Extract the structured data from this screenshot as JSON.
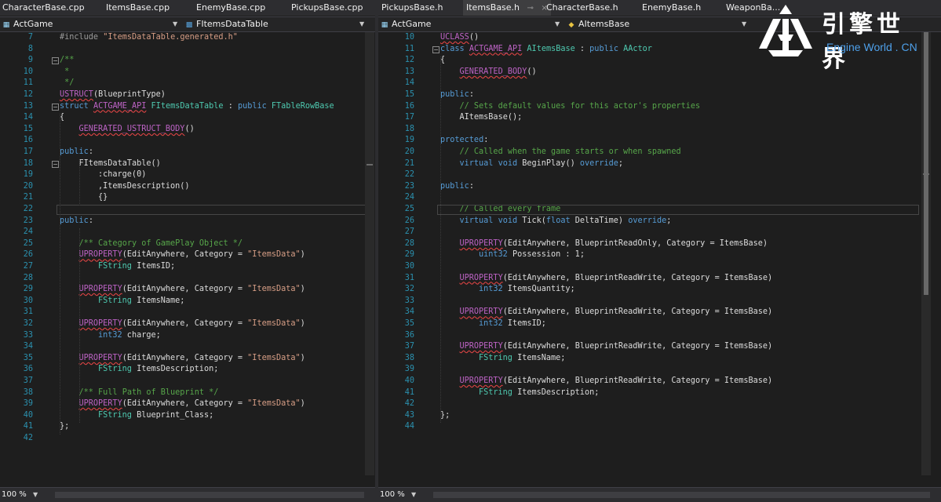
{
  "left_editor": {
    "tabs": [
      {
        "label": "CharacterBase.cpp"
      },
      {
        "label": "ItemsBase.cpp"
      },
      {
        "label": "EnemyBase.cpp"
      },
      {
        "label": "PickupsBase.cpp"
      }
    ],
    "project_label": "ActGame",
    "scope_label": "FItemsDataTable",
    "zoom": "100 %",
    "lines": [
      {
        "n": "7",
        "indent": 0,
        "segs": [
          {
            "c": "p",
            "t": "#include "
          },
          {
            "c": "s",
            "t": "\"ItemsDataTable.generated.h\""
          }
        ]
      },
      {
        "n": "8",
        "indent": 0,
        "segs": []
      },
      {
        "n": "9",
        "indent": 0,
        "segs": [
          {
            "c": "c",
            "t": "/**"
          }
        ]
      },
      {
        "n": "10",
        "indent": 0,
        "segs": [
          {
            "c": "c",
            "t": " *"
          }
        ]
      },
      {
        "n": "11",
        "indent": 0,
        "segs": [
          {
            "c": "c",
            "t": " */"
          }
        ]
      },
      {
        "n": "12",
        "indent": 0,
        "segs": [
          {
            "c": "m u",
            "t": "USTRUCT"
          },
          {
            "c": "pl",
            "t": "(BlueprintType)"
          }
        ]
      },
      {
        "n": "13",
        "indent": 0,
        "segs": [
          {
            "c": "k",
            "t": "struct "
          },
          {
            "c": "m u",
            "t": "ACTGAME_API"
          },
          {
            "c": "pl",
            "t": " "
          },
          {
            "c": "t",
            "t": "FItemsDataTable"
          },
          {
            "c": "pl",
            "t": " : "
          },
          {
            "c": "k",
            "t": "public "
          },
          {
            "c": "t",
            "t": "FTableRowBase"
          }
        ]
      },
      {
        "n": "14",
        "indent": 0,
        "segs": [
          {
            "c": "pl",
            "t": "{"
          }
        ]
      },
      {
        "n": "15",
        "indent": 1,
        "segs": [
          {
            "c": "m u",
            "t": "GENERATED_USTRUCT_BODY"
          },
          {
            "c": "pl",
            "t": "()"
          }
        ]
      },
      {
        "n": "16",
        "indent": 0,
        "segs": []
      },
      {
        "n": "17",
        "indent": 0,
        "segs": [
          {
            "c": "k",
            "t": "public"
          },
          {
            "c": "pl",
            "t": ":"
          }
        ]
      },
      {
        "n": "18",
        "indent": 1,
        "segs": [
          {
            "c": "pl",
            "t": "FItemsDataTable()"
          }
        ]
      },
      {
        "n": "19",
        "indent": 2,
        "segs": [
          {
            "c": "pl",
            "t": ":charge(0)"
          }
        ]
      },
      {
        "n": "20",
        "indent": 2,
        "segs": [
          {
            "c": "pl",
            "t": ",ItemsDescription()"
          }
        ]
      },
      {
        "n": "21",
        "indent": 2,
        "segs": [
          {
            "c": "pl",
            "t": "{}"
          }
        ]
      },
      {
        "n": "22",
        "indent": 0,
        "segs": []
      },
      {
        "n": "23",
        "indent": 0,
        "segs": [
          {
            "c": "k",
            "t": "public"
          },
          {
            "c": "pl",
            "t": ":"
          }
        ]
      },
      {
        "n": "24",
        "indent": 0,
        "segs": []
      },
      {
        "n": "25",
        "indent": 1,
        "segs": [
          {
            "c": "c",
            "t": "/** Category of GamePlay Object */"
          }
        ]
      },
      {
        "n": "26",
        "indent": 1,
        "segs": [
          {
            "c": "m u",
            "t": "UPROPERTY"
          },
          {
            "c": "pl",
            "t": "(EditAnywhere, Category = "
          },
          {
            "c": "s",
            "t": "\"ItemsData\""
          },
          {
            "c": "pl",
            "t": ")"
          }
        ]
      },
      {
        "n": "27",
        "indent": 2,
        "segs": [
          {
            "c": "t",
            "t": "FString"
          },
          {
            "c": "pl",
            "t": " ItemsID;"
          }
        ]
      },
      {
        "n": "28",
        "indent": 0,
        "segs": []
      },
      {
        "n": "29",
        "indent": 1,
        "segs": [
          {
            "c": "m u",
            "t": "UPROPERTY"
          },
          {
            "c": "pl",
            "t": "(EditAnywhere, Category = "
          },
          {
            "c": "s",
            "t": "\"ItemsData\""
          },
          {
            "c": "pl",
            "t": ")"
          }
        ]
      },
      {
        "n": "30",
        "indent": 2,
        "segs": [
          {
            "c": "t",
            "t": "FString"
          },
          {
            "c": "pl",
            "t": " ItemsName;"
          }
        ]
      },
      {
        "n": "31",
        "indent": 0,
        "segs": []
      },
      {
        "n": "32",
        "indent": 1,
        "segs": [
          {
            "c": "m u",
            "t": "UPROPERTY"
          },
          {
            "c": "pl",
            "t": "(EditAnywhere, Category = "
          },
          {
            "c": "s",
            "t": "\"ItemsData\""
          },
          {
            "c": "pl",
            "t": ")"
          }
        ]
      },
      {
        "n": "33",
        "indent": 2,
        "segs": [
          {
            "c": "k",
            "t": "int32"
          },
          {
            "c": "pl",
            "t": " charge;"
          }
        ]
      },
      {
        "n": "34",
        "indent": 0,
        "segs": []
      },
      {
        "n": "35",
        "indent": 1,
        "segs": [
          {
            "c": "m u",
            "t": "UPROPERTY"
          },
          {
            "c": "pl",
            "t": "(EditAnywhere, Category = "
          },
          {
            "c": "s",
            "t": "\"ItemsData\""
          },
          {
            "c": "pl",
            "t": ")"
          }
        ]
      },
      {
        "n": "36",
        "indent": 2,
        "segs": [
          {
            "c": "t",
            "t": "FString"
          },
          {
            "c": "pl",
            "t": " ItemsDescription;"
          }
        ]
      },
      {
        "n": "37",
        "indent": 0,
        "segs": []
      },
      {
        "n": "38",
        "indent": 1,
        "segs": [
          {
            "c": "c",
            "t": "/** Full Path of Blueprint */"
          }
        ]
      },
      {
        "n": "39",
        "indent": 1,
        "segs": [
          {
            "c": "m u",
            "t": "UPROPERTY"
          },
          {
            "c": "pl",
            "t": "(EditAnywhere, Category = "
          },
          {
            "c": "s",
            "t": "\"ItemsData\""
          },
          {
            "c": "pl",
            "t": ")"
          }
        ]
      },
      {
        "n": "40",
        "indent": 2,
        "segs": [
          {
            "c": "t",
            "t": "FString"
          },
          {
            "c": "pl",
            "t": " Blueprint_Class;"
          }
        ]
      },
      {
        "n": "41",
        "indent": 0,
        "segs": [
          {
            "c": "pl",
            "t": "};"
          }
        ]
      },
      {
        "n": "42",
        "indent": 0,
        "segs": []
      }
    ]
  },
  "right_editor": {
    "tabs": [
      {
        "label": "PickupsBase.h"
      },
      {
        "label": "ItemsBase.h"
      },
      {
        "label": "CharacterBase.h"
      },
      {
        "label": "EnemyBase.h"
      },
      {
        "label": "WeaponBa..."
      }
    ],
    "tab_pin": "⊸",
    "tab_close": "×",
    "project_label": "ActGame",
    "scope_label": "AItemsBase",
    "zoom": "100 %",
    "lines": [
      {
        "n": "10",
        "indent": 0,
        "segs": [
          {
            "c": "m u",
            "t": "UCLASS"
          },
          {
            "c": "pl",
            "t": "()"
          }
        ]
      },
      {
        "n": "11",
        "indent": 0,
        "segs": [
          {
            "c": "k",
            "t": "class "
          },
          {
            "c": "m u",
            "t": "ACTGAME_API"
          },
          {
            "c": "pl",
            "t": " "
          },
          {
            "c": "t",
            "t": "AItemsBase"
          },
          {
            "c": "pl",
            "t": " : "
          },
          {
            "c": "k",
            "t": "public "
          },
          {
            "c": "t",
            "t": "AActor"
          }
        ]
      },
      {
        "n": "12",
        "indent": 0,
        "segs": [
          {
            "c": "pl",
            "t": "{"
          }
        ]
      },
      {
        "n": "13",
        "indent": 1,
        "segs": [
          {
            "c": "m u",
            "t": "GENERATED_BODY"
          },
          {
            "c": "pl",
            "t": "()"
          }
        ]
      },
      {
        "n": "14",
        "indent": 0,
        "segs": []
      },
      {
        "n": "15",
        "indent": 0,
        "segs": [
          {
            "c": "k",
            "t": "public"
          },
          {
            "c": "pl",
            "t": ":"
          }
        ]
      },
      {
        "n": "16",
        "indent": 1,
        "segs": [
          {
            "c": "c",
            "t": "// Sets default values for this actor's properties"
          }
        ]
      },
      {
        "n": "17",
        "indent": 1,
        "segs": [
          {
            "c": "pl",
            "t": "AItemsBase();"
          }
        ]
      },
      {
        "n": "18",
        "indent": 0,
        "segs": []
      },
      {
        "n": "19",
        "indent": 0,
        "segs": [
          {
            "c": "k",
            "t": "protected"
          },
          {
            "c": "pl",
            "t": ":"
          }
        ]
      },
      {
        "n": "20",
        "indent": 1,
        "segs": [
          {
            "c": "c",
            "t": "// Called when the game starts or when spawned"
          }
        ]
      },
      {
        "n": "21",
        "indent": 1,
        "segs": [
          {
            "c": "k",
            "t": "virtual void"
          },
          {
            "c": "pl",
            "t": " BeginPlay() "
          },
          {
            "c": "k",
            "t": "override"
          },
          {
            "c": "pl",
            "t": ";"
          }
        ]
      },
      {
        "n": "22",
        "indent": 0,
        "segs": []
      },
      {
        "n": "23",
        "indent": 0,
        "segs": [
          {
            "c": "k",
            "t": "public"
          },
          {
            "c": "pl",
            "t": ":"
          }
        ]
      },
      {
        "n": "24",
        "indent": 0,
        "segs": []
      },
      {
        "n": "25",
        "indent": 1,
        "segs": [
          {
            "c": "c",
            "t": "// Called every frame"
          }
        ]
      },
      {
        "n": "26",
        "indent": 1,
        "segs": [
          {
            "c": "k",
            "t": "virtual void"
          },
          {
            "c": "pl",
            "t": " Tick("
          },
          {
            "c": "k",
            "t": "float"
          },
          {
            "c": "pl",
            "t": " DeltaTime) "
          },
          {
            "c": "k",
            "t": "override"
          },
          {
            "c": "pl",
            "t": ";"
          }
        ]
      },
      {
        "n": "27",
        "indent": 0,
        "segs": []
      },
      {
        "n": "28",
        "indent": 1,
        "segs": [
          {
            "c": "m u",
            "t": "UPROPERTY"
          },
          {
            "c": "pl",
            "t": "(EditAnywhere, BlueprintReadOnly, Category = ItemsBase)"
          }
        ]
      },
      {
        "n": "29",
        "indent": 2,
        "segs": [
          {
            "c": "k",
            "t": "uint32"
          },
          {
            "c": "pl",
            "t": " Possession : 1;"
          }
        ]
      },
      {
        "n": "30",
        "indent": 0,
        "segs": []
      },
      {
        "n": "31",
        "indent": 1,
        "segs": [
          {
            "c": "m u",
            "t": "UPROPERTY"
          },
          {
            "c": "pl",
            "t": "(EditAnywhere, BlueprintReadWrite, Category = ItemsBase)"
          }
        ]
      },
      {
        "n": "32",
        "indent": 2,
        "segs": [
          {
            "c": "k",
            "t": "int32"
          },
          {
            "c": "pl",
            "t": " ItemsQuantity;"
          }
        ]
      },
      {
        "n": "33",
        "indent": 0,
        "segs": []
      },
      {
        "n": "34",
        "indent": 1,
        "segs": [
          {
            "c": "m u",
            "t": "UPROPERTY"
          },
          {
            "c": "pl",
            "t": "(EditAnywhere, BlueprintReadWrite, Category = ItemsBase)"
          }
        ]
      },
      {
        "n": "35",
        "indent": 2,
        "segs": [
          {
            "c": "k",
            "t": "int32"
          },
          {
            "c": "pl",
            "t": " ItemsID;"
          }
        ]
      },
      {
        "n": "36",
        "indent": 0,
        "segs": []
      },
      {
        "n": "37",
        "indent": 1,
        "segs": [
          {
            "c": "m u",
            "t": "UPROPERTY"
          },
          {
            "c": "pl",
            "t": "(EditAnywhere, BlueprintReadWrite, Category = ItemsBase)"
          }
        ]
      },
      {
        "n": "38",
        "indent": 2,
        "segs": [
          {
            "c": "t",
            "t": "FString"
          },
          {
            "c": "pl",
            "t": " ItemsName;"
          }
        ]
      },
      {
        "n": "39",
        "indent": 0,
        "segs": []
      },
      {
        "n": "40",
        "indent": 1,
        "segs": [
          {
            "c": "m u",
            "t": "UPROPERTY"
          },
          {
            "c": "pl",
            "t": "(EditAnywhere, BlueprintReadWrite, Category = ItemsBase)"
          }
        ]
      },
      {
        "n": "41",
        "indent": 2,
        "segs": [
          {
            "c": "t",
            "t": "FString"
          },
          {
            "c": "pl",
            "t": " ItemsDescription;"
          }
        ]
      },
      {
        "n": "42",
        "indent": 0,
        "segs": []
      },
      {
        "n": "43",
        "indent": 0,
        "segs": [
          {
            "c": "pl",
            "t": "};"
          }
        ]
      },
      {
        "n": "44",
        "indent": 0,
        "segs": []
      }
    ]
  },
  "watermark": {
    "chinese": "引擎世界",
    "english": "Engine World . CN"
  },
  "colors": {
    "background": "#1e1e1e",
    "line_number": "#2b91af",
    "keyword": "#569cd6",
    "type": "#4ec9b0",
    "comment": "#57a64a",
    "string": "#d69d85",
    "macro": "#bd63c5",
    "logo_accent": "#4ea0ea"
  }
}
